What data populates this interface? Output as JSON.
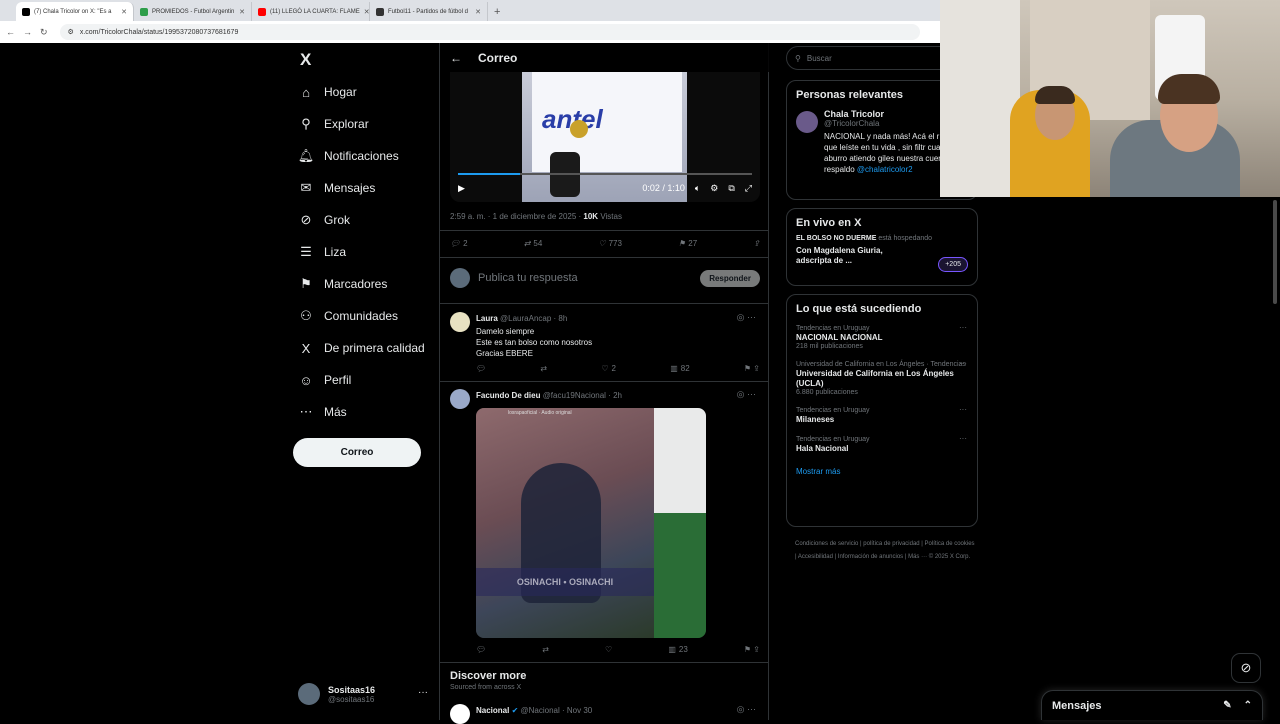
{
  "browser": {
    "tabs": [
      {
        "label": "(7) Chala Tricolor on X: \"Es a",
        "color": "#000000",
        "active": true
      },
      {
        "label": "PROMIEDOS - Futbol Argentin",
        "color": "#2e9e4a",
        "active": false
      },
      {
        "label": "(11) LLEGÓ LA CUARTA: FLAME",
        "color": "#ff0000",
        "active": false
      },
      {
        "label": "Futbol11 - Partidos de fútbol d",
        "color": "#333333",
        "active": false
      }
    ],
    "new_tab": "+",
    "url": "x.com/TricolorChala/status/1995372080737681679"
  },
  "nav": {
    "logo": "X",
    "items": [
      {
        "label": "Hogar",
        "icon": "home-icon",
        "glyph": "⌂"
      },
      {
        "label": "Explorar",
        "icon": "search-icon",
        "glyph": "⚲"
      },
      {
        "label": "Notificaciones",
        "icon": "bell-icon",
        "glyph": "🔔︎"
      },
      {
        "label": "Mensajes",
        "icon": "mail-icon",
        "glyph": "✉"
      },
      {
        "label": "Grok",
        "icon": "grok-icon",
        "glyph": "⊘"
      },
      {
        "label": "Liza",
        "icon": "list-icon",
        "glyph": "☰"
      },
      {
        "label": "Marcadores",
        "icon": "bookmark-icon",
        "glyph": "⚑"
      },
      {
        "label": "Comunidades",
        "icon": "people-icon",
        "glyph": "⚇"
      },
      {
        "label": "De primera calidad",
        "icon": "x-premium-icon",
        "glyph": "X"
      },
      {
        "label": "Perfil",
        "icon": "person-icon",
        "glyph": "☺"
      },
      {
        "label": "Más",
        "icon": "more-icon",
        "glyph": "⋯"
      }
    ],
    "post_button": "Correo",
    "account": {
      "name": "Sositaas16",
      "handle": "@sositaas16",
      "more": "···"
    }
  },
  "main": {
    "back": "←",
    "title": "Correo",
    "video": {
      "brand": "antel",
      "time": "0:02 / 1:10",
      "progress": 0.21
    },
    "meta": {
      "time": "2:59 a. m. · 1 de diciembre de 2025 · ",
      "views": "10K",
      "views_label": " Vistas"
    },
    "stats": {
      "replies": "2",
      "reposts": "54",
      "likes": "773",
      "bookmarks": "27"
    },
    "reply_placeholder": "Publica tu respuesta",
    "reply_button": "Responder",
    "replies": [
      {
        "name": "Laura",
        "handle": "@LauraAncap · 8h",
        "lines": [
          "Damelo siempre",
          "Este es tan bolso como nosotros",
          "Gracias EBERE"
        ],
        "replies": "",
        "reposts": "",
        "likes": "2",
        "views": "82"
      },
      {
        "name": "Facundo De dieu",
        "handle": "@facu19Nacional · 2h",
        "likes": "",
        "views": "23",
        "media_caption": "losrapaoficial · Audio original",
        "media_overlay": "OSINACHI • OSINACHI"
      }
    ],
    "discover_title": "Discover more",
    "discover_sub": "Sourced from across X",
    "next_post": {
      "name": "Nacional",
      "handle": "@Nacional · Nov 30"
    }
  },
  "sidebar": {
    "search_placeholder": "Buscar",
    "relevant_title": "Personas relevantes",
    "person": {
      "name": "Chala Tricolor",
      "handle": "@TricolorChala",
      "bio": "NACIONAL y nada más! Acá el r 1x1 que leíste en tu vida , sin filtr cuando me aburro atiendo giles nuestra cuenta de respaldo",
      "link": "@chalatricolor2"
    },
    "live_title": "En vivo en X",
    "live": {
      "host_name": "EL BOLSO NO DUERME",
      "host_suffix": " está hospedando",
      "title": "Con Magdalena Giuria, adscripta de ...",
      "count": "+205"
    },
    "trends_title": "Lo que está sucediendo",
    "trends": [
      {
        "context": "Tendencias en Uruguay",
        "name": "NACIONAL NACIONAL",
        "count": "218 mil publicaciones"
      },
      {
        "context": "Universidad de California en Los Ángeles · Tendencias",
        "name": "Universidad de California en Los Ángeles (UCLA)",
        "count": "6.880 publicaciones"
      },
      {
        "context": "Tendencias en Uruguay",
        "name": "Milaneses",
        "count": ""
      },
      {
        "context": "Tendencias en Uruguay",
        "name": "Hala Nacional",
        "count": ""
      }
    ],
    "show_more": "Mostrar más",
    "footer": "Condiciones de servicio | política de privacidad | Política de cookies | Accesibilidad | Información de anuncios | Más ··· © 2025 X Corp."
  },
  "dm_drawer": {
    "title": "Mensajes"
  }
}
